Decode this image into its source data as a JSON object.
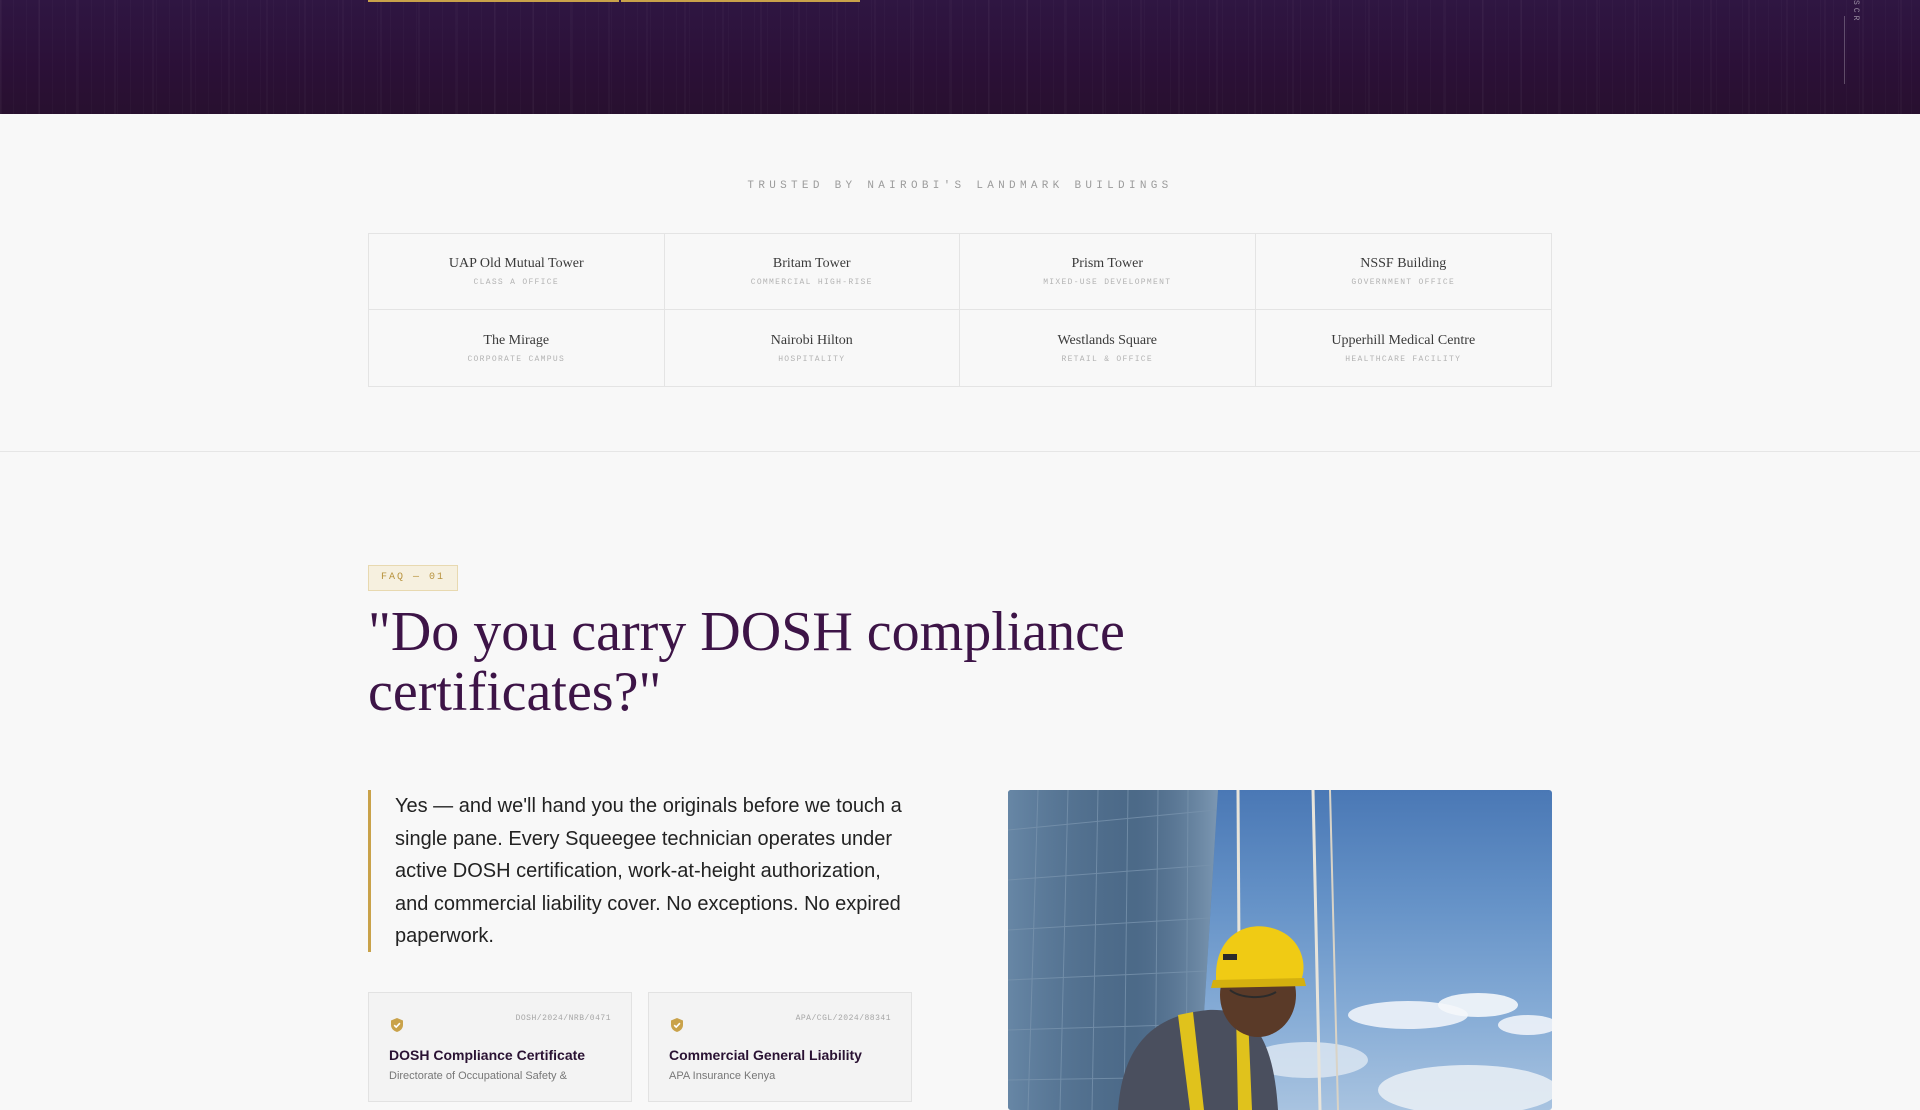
{
  "hero": {
    "vertical_text": "SCROLL"
  },
  "trusted": {
    "label": "TRUSTED BY NAIROBI'S LANDMARK BUILDINGS",
    "buildings": [
      {
        "name": "UAP Old Mutual Tower",
        "type": "CLASS A OFFICE"
      },
      {
        "name": "Britam Tower",
        "type": "COMMERCIAL HIGH-RISE"
      },
      {
        "name": "Prism Tower",
        "type": "MIXED-USE DEVELOPMENT"
      },
      {
        "name": "NSSF Building",
        "type": "GOVERNMENT OFFICE"
      },
      {
        "name": "The Mirage",
        "type": "CORPORATE CAMPUS"
      },
      {
        "name": "Nairobi Hilton",
        "type": "HOSPITALITY"
      },
      {
        "name": "Westlands Square",
        "type": "RETAIL & OFFICE"
      },
      {
        "name": "Upperhill Medical Centre",
        "type": "HEALTHCARE FACILITY"
      }
    ]
  },
  "faq": {
    "tag": "FAQ — 01",
    "question": "\"Do you carry DOSH compliance certificates?\"",
    "answer": "Yes — and we'll hand you the originals before we touch a single pane. Every Squeegee technician operates under active DOSH certification, work-at-height authorization, and commercial liability cover. No exceptions. No expired paperwork.",
    "certificates": [
      {
        "code": "DOSH/2024/NRB/0471",
        "title": "DOSH Compliance Certificate",
        "subtitle": "Directorate of Occupational Safety &",
        "icon": "shield-check-icon"
      },
      {
        "code": "APA/CGL/2024/88341",
        "title": "Commercial General Liability",
        "subtitle": "APA Insurance Kenya",
        "icon": "shield-check-icon"
      }
    ]
  },
  "colors": {
    "accent": "#c9a24a",
    "brand": "#3d1447",
    "hero_bg": "#2b1037"
  }
}
